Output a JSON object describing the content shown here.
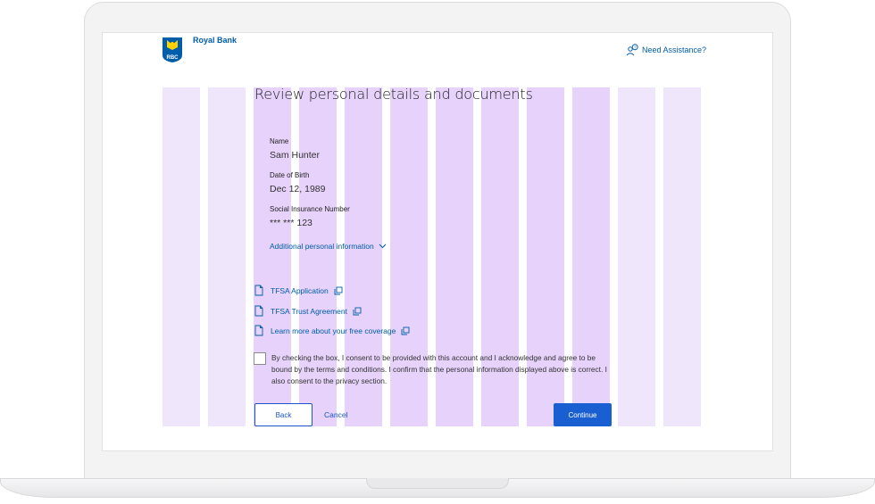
{
  "header": {
    "brand_name": "Royal Bank",
    "logo_text": "RBC",
    "assist_label": "Need Assistance?"
  },
  "page": {
    "title": "Review personal details and documents"
  },
  "details": {
    "name_label": "Name",
    "name_value": "Sam Hunter",
    "dob_label": "Date of Birth",
    "dob_value": "Dec 12, 1989",
    "sin_label": "Social Insurance Number",
    "sin_value": "*** *** 123",
    "more_label": "Additional personal information"
  },
  "documents": [
    {
      "label": "TFSA Application"
    },
    {
      "label": "TFSA Trust Agreement"
    },
    {
      "label": "Learn more about your free coverage"
    }
  ],
  "consent": {
    "checked": false,
    "text": "By checking the box, I consent to be provided with this account and I acknowledge and agree to be bound by the terms and conditions. I confirm that the personal information displayed above is correct. I also consent to the privacy section."
  },
  "actions": {
    "back_label": "Back",
    "cancel_label": "Cancel",
    "continue_label": "Continue"
  },
  "colors": {
    "link": "#005daa",
    "primary": "#1a5fd1",
    "grid_outer": "#efe6fb",
    "grid_inner": "#e6d2fb"
  },
  "icons": {
    "assist": "person-question-icon",
    "document": "document-icon",
    "copy": "copy-icon",
    "chevron": "chevron-down-icon"
  }
}
